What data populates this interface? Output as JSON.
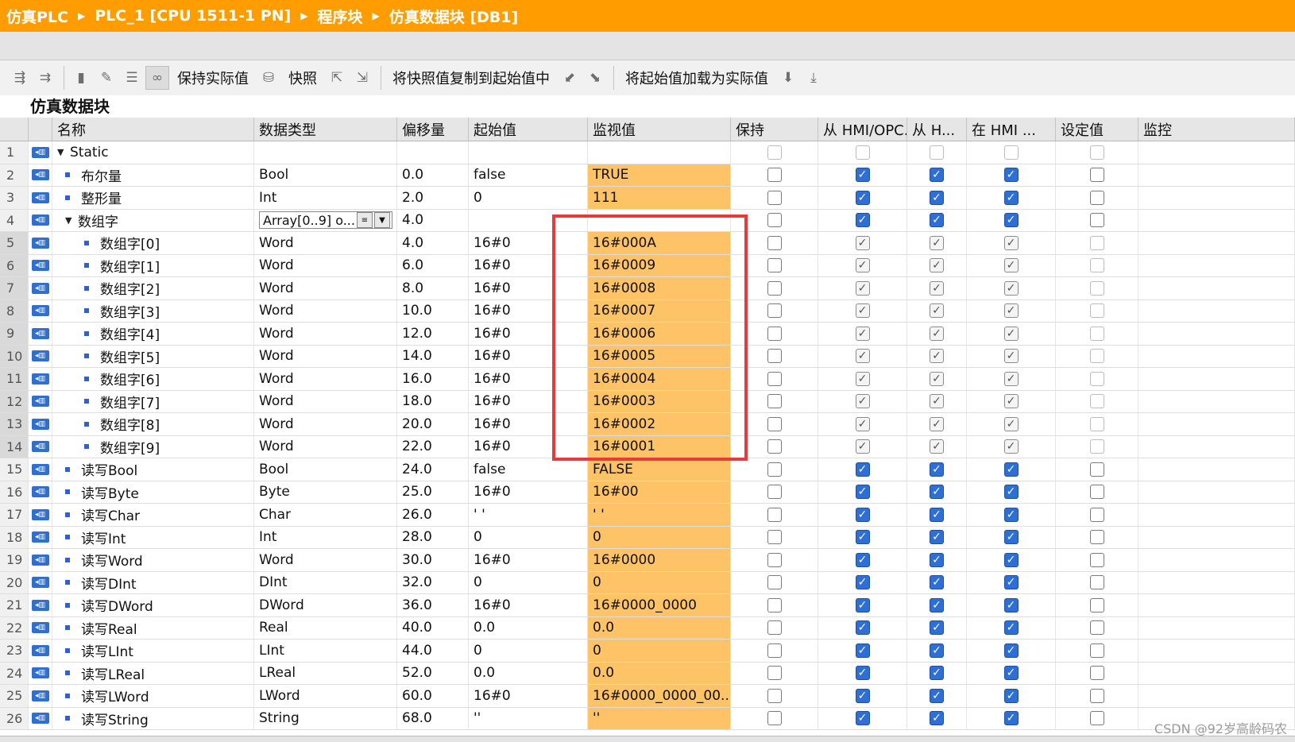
{
  "breadcrumb": [
    "仿真PLC",
    "PLC_1 [CPU 1511-1 PN]",
    "程序块",
    "仿真数据块 [DB1]"
  ],
  "toolbar": {
    "keep_actual": "保持实际值",
    "snapshot": "快照",
    "copy_snapshot": "将快照值复制到起始值中",
    "load_start": "将起始值加载为实际值"
  },
  "panel_title": "仿真数据块",
  "columns": [
    "名称",
    "数据类型",
    "偏移量",
    "起始值",
    "监视值",
    "保持",
    "从 HMI/OPC..",
    "从 H...",
    "在 HMI ...",
    "设定值",
    "监控"
  ],
  "rows": [
    {
      "n": "1",
      "name": "Static",
      "type": "",
      "off": "",
      "start": "",
      "mon": "",
      "lvl": 0,
      "tri": "▼"
    },
    {
      "n": "2",
      "name": "布尔量",
      "type": "Bool",
      "off": "0.0",
      "start": "false",
      "mon": "TRUE",
      "lvl": 1
    },
    {
      "n": "3",
      "name": "整形量",
      "type": "Int",
      "off": "2.0",
      "start": "0",
      "mon": "111",
      "lvl": 1
    },
    {
      "n": "4",
      "name": "数组字",
      "type": "Array[0..9] o...",
      "off": "4.0",
      "start": "",
      "mon": "",
      "lvl": 1,
      "tri": "▼"
    },
    {
      "n": "5",
      "name": "数组字[0]",
      "type": "Word",
      "off": "4.0",
      "start": "16#0",
      "mon": "16#000A",
      "lvl": 2
    },
    {
      "n": "6",
      "name": "数组字[1]",
      "type": "Word",
      "off": "6.0",
      "start": "16#0",
      "mon": "16#0009",
      "lvl": 2
    },
    {
      "n": "7",
      "name": "数组字[2]",
      "type": "Word",
      "off": "8.0",
      "start": "16#0",
      "mon": "16#0008",
      "lvl": 2
    },
    {
      "n": "8",
      "name": "数组字[3]",
      "type": "Word",
      "off": "10.0",
      "start": "16#0",
      "mon": "16#0007",
      "lvl": 2
    },
    {
      "n": "9",
      "name": "数组字[4]",
      "type": "Word",
      "off": "12.0",
      "start": "16#0",
      "mon": "16#0006",
      "lvl": 2
    },
    {
      "n": "10",
      "name": "数组字[5]",
      "type": "Word",
      "off": "14.0",
      "start": "16#0",
      "mon": "16#0005",
      "lvl": 2
    },
    {
      "n": "11",
      "name": "数组字[6]",
      "type": "Word",
      "off": "16.0",
      "start": "16#0",
      "mon": "16#0004",
      "lvl": 2
    },
    {
      "n": "12",
      "name": "数组字[7]",
      "type": "Word",
      "off": "18.0",
      "start": "16#0",
      "mon": "16#0003",
      "lvl": 2
    },
    {
      "n": "13",
      "name": "数组字[8]",
      "type": "Word",
      "off": "20.0",
      "start": "16#0",
      "mon": "16#0002",
      "lvl": 2
    },
    {
      "n": "14",
      "name": "数组字[9]",
      "type": "Word",
      "off": "22.0",
      "start": "16#0",
      "mon": "16#0001",
      "lvl": 2
    },
    {
      "n": "15",
      "name": "读写Bool",
      "type": "Bool",
      "off": "24.0",
      "start": "false",
      "mon": "FALSE",
      "lvl": 1
    },
    {
      "n": "16",
      "name": "读写Byte",
      "type": "Byte",
      "off": "25.0",
      "start": "16#0",
      "mon": "16#00",
      "lvl": 1
    },
    {
      "n": "17",
      "name": "读写Char",
      "type": "Char",
      "off": "26.0",
      "start": "' '",
      "mon": "' '",
      "lvl": 1
    },
    {
      "n": "18",
      "name": "读写Int",
      "type": "Int",
      "off": "28.0",
      "start": "0",
      "mon": "0",
      "lvl": 1
    },
    {
      "n": "19",
      "name": "读写Word",
      "type": "Word",
      "off": "30.0",
      "start": "16#0",
      "mon": "16#0000",
      "lvl": 1
    },
    {
      "n": "20",
      "name": "读写DInt",
      "type": "DInt",
      "off": "32.0",
      "start": "0",
      "mon": "0",
      "lvl": 1
    },
    {
      "n": "21",
      "name": "读写DWord",
      "type": "DWord",
      "off": "36.0",
      "start": "16#0",
      "mon": "16#0000_0000",
      "lvl": 1
    },
    {
      "n": "22",
      "name": "读写Real",
      "type": "Real",
      "off": "40.0",
      "start": "0.0",
      "mon": "0.0",
      "lvl": 1
    },
    {
      "n": "23",
      "name": "读写LInt",
      "type": "LInt",
      "off": "44.0",
      "start": "0",
      "mon": "0",
      "lvl": 1
    },
    {
      "n": "24",
      "name": "读写LReal",
      "type": "LReal",
      "off": "52.0",
      "start": "0.0",
      "mon": "0.0",
      "lvl": 1
    },
    {
      "n": "25",
      "name": "读写LWord",
      "type": "LWord",
      "off": "60.0",
      "start": "16#0",
      "mon": "16#0000_0000_00...",
      "lvl": 1
    },
    {
      "n": "26",
      "name": "读写String",
      "type": "String",
      "off": "68.0",
      "start": "''",
      "mon": "''",
      "lvl": 1
    }
  ],
  "watermark": "CSDN @92岁高龄码农"
}
